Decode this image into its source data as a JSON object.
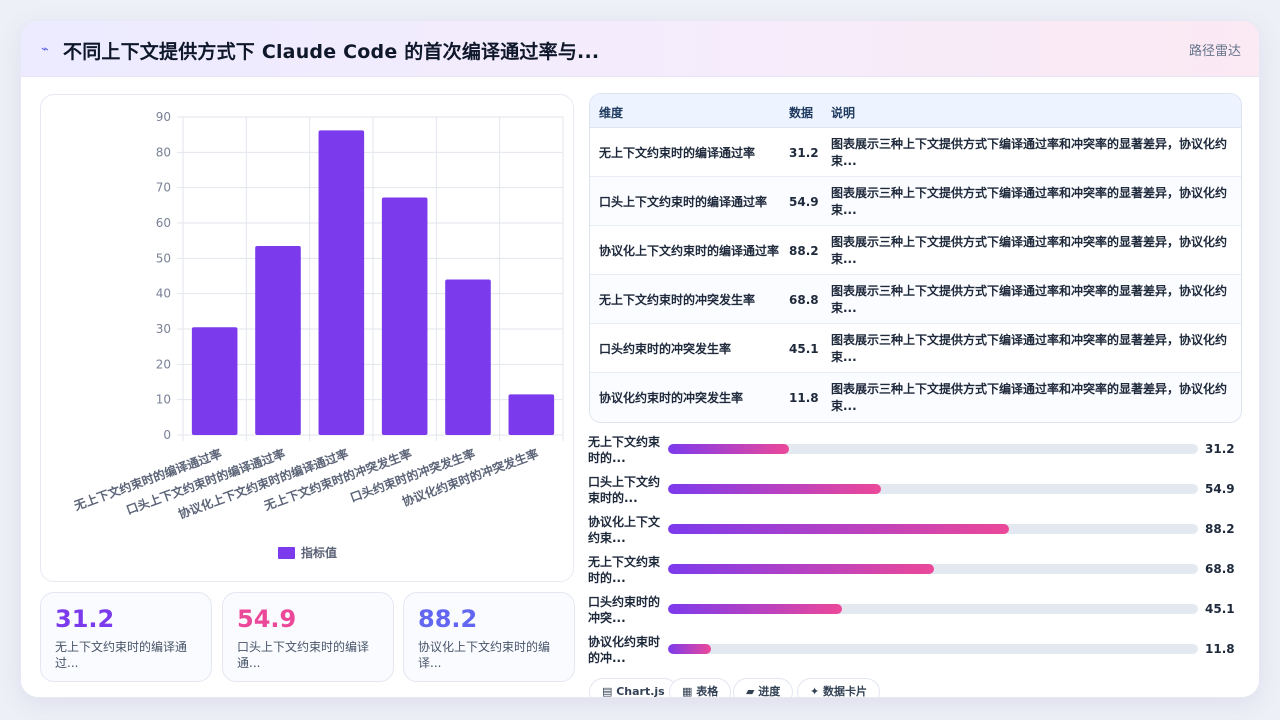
{
  "header": {
    "icon": "sparkle-line-icon",
    "title": "不同上下文提供方式下 Claude Code 的首次编译通过率与...",
    "action_label": "路径雷达"
  },
  "chart_data": {
    "type": "bar",
    "categories": [
      "无上下文约束时的编译通过率",
      "口头上下文约束时的编译通过率",
      "协议化上下文约束时的编译通过率",
      "无上下文约束时的冲突发生率",
      "口头约束时的冲突发生率",
      "协议化约束时的冲突发生率"
    ],
    "series": [
      {
        "name": "指标值",
        "values": [
          30.5,
          53.5,
          86.2,
          67.2,
          44.0,
          11.5
        ],
        "color": "#7c3aed"
      }
    ],
    "ylim": [
      0,
      90
    ],
    "yticks": [
      0,
      10,
      20,
      30,
      40,
      50,
      60,
      70,
      80,
      90
    ],
    "grid": true,
    "legend_position": "bottom"
  },
  "kpis": [
    {
      "value": "31.2",
      "label": "无上下文约束时的编译通过...",
      "color": "#7c3aed"
    },
    {
      "value": "54.9",
      "label": "口头上下文约束时的编译通...",
      "color": "#ec4899"
    },
    {
      "value": "88.2",
      "label": "协议化上下文约束时的编译...",
      "color": "#6366f1"
    }
  ],
  "table": {
    "headers": {
      "dimension": "维度",
      "value": "数据",
      "description": "说明"
    },
    "rows": [
      {
        "dimension": "无上下文约束时的编译通过率",
        "value": "31.2",
        "description": "图表展示三种上下文提供方式下编译通过率和冲突率的显著差异，协议化约束..."
      },
      {
        "dimension": "口头上下文约束时的编译通过率",
        "value": "54.9",
        "description": "图表展示三种上下文提供方式下编译通过率和冲突率的显著差异，协议化约束..."
      },
      {
        "dimension": "协议化上下文约束时的编译通过率",
        "value": "88.2",
        "description": "图表展示三种上下文提供方式下编译通过率和冲突率的显著差异，协议化约束..."
      },
      {
        "dimension": "无上下文约束时的冲突发生率",
        "value": "68.8",
        "description": "图表展示三种上下文提供方式下编译通过率和冲突率的显著差异，协议化约束..."
      },
      {
        "dimension": "口头约束时的冲突发生率",
        "value": "45.1",
        "description": "图表展示三种上下文提供方式下编译通过率和冲突率的显著差异，协议化约束..."
      },
      {
        "dimension": "协议化约束时的冲突发生率",
        "value": "11.8",
        "description": "图表展示三种上下文提供方式下编译通过率和冲突率的显著差异，协议化约束..."
      }
    ]
  },
  "progress_bars": [
    {
      "label": "无上下文约束时的...",
      "value": "31.2",
      "percent": 22.8
    },
    {
      "label": "口头上下文约束时的...",
      "value": "54.9",
      "percent": 40.1
    },
    {
      "label": "协议化上下文约束...",
      "value": "88.2",
      "percent": 64.4
    },
    {
      "label": "无上下文约束时的...",
      "value": "68.8",
      "percent": 50.2
    },
    {
      "label": "口头约束时的冲突...",
      "value": "45.1",
      "percent": 32.9
    },
    {
      "label": "协议化约束时的冲...",
      "value": "11.8",
      "percent": 8.1
    }
  ],
  "tags": [
    {
      "label": "▤ Chart.js",
      "icon": "chart-icon"
    },
    {
      "label": "▦ 表格",
      "icon": "table-icon"
    },
    {
      "label": "▰ 进度",
      "icon": "progress-icon"
    },
    {
      "label": "✦ 数据卡片",
      "icon": "card-icon"
    }
  ],
  "colors": {
    "accent": "#7c3aed",
    "accent2": "#ec4899",
    "accent3": "#6366f1"
  }
}
